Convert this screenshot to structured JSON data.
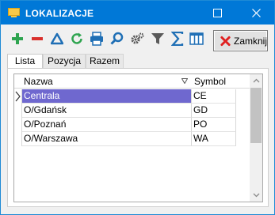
{
  "window": {
    "title": "LOKALIZACJE"
  },
  "toolbar": {
    "icons": [
      "add-icon",
      "remove-icon",
      "delta-icon",
      "refresh-icon",
      "print-icon",
      "search-icon",
      "settings-gear-icon",
      "filter-icon",
      "sum-icon",
      "columns-icon"
    ],
    "close_label": "Zamknij"
  },
  "tabs": [
    {
      "label": "Lista",
      "active": true
    },
    {
      "label": "Pozycja",
      "active": false
    },
    {
      "label": "Razem",
      "active": false
    }
  ],
  "grid": {
    "columns": {
      "name": "Nazwa",
      "symbol": "Symbol"
    },
    "rows": [
      {
        "name": "Centrala",
        "symbol": "CE",
        "selected": true
      },
      {
        "name": "O/Gdańsk",
        "symbol": "GD",
        "selected": false
      },
      {
        "name": "O/Poznań",
        "symbol": "PO",
        "selected": false
      },
      {
        "name": "O/Warszawa",
        "symbol": "WA",
        "selected": false
      }
    ]
  },
  "colors": {
    "titlebar": "#0078d7",
    "selection": "#6f68cf",
    "close_x": "#e02020",
    "add": "#2ea44f",
    "remove": "#d9302c",
    "toolbar_blue": "#1f6fb5"
  }
}
